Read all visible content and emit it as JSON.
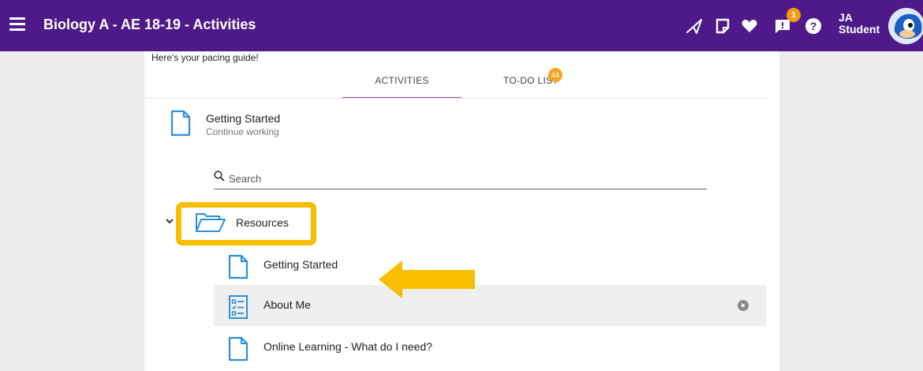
{
  "header": {
    "title": "Biology A - AE 18-19 - Activities",
    "notification_count": "1",
    "user_initials": "JA",
    "user_label": "Student"
  },
  "panel": {
    "pacing_text": "Here's your pacing guide!",
    "tabs": [
      {
        "label": "ACTIVITIES",
        "active": true
      },
      {
        "label": "TO-DO LIST",
        "badge": "44"
      }
    ],
    "continue_item": {
      "title": "Getting Started",
      "subtitle": "Continue working"
    },
    "search": {
      "placeholder": "Search"
    },
    "folder": {
      "label": "Resources",
      "expanded": true,
      "items": [
        {
          "label": "Getting Started",
          "icon": "document-icon"
        },
        {
          "label": "About Me",
          "icon": "checklist-icon"
        },
        {
          "label": "Online Learning - What do I need?",
          "icon": "document-icon"
        }
      ]
    }
  },
  "colors": {
    "header_bg": "#4e1a8a",
    "accent": "#a64ac9",
    "icon_blue": "#2d8fd9",
    "highlight": "#f7bd00"
  }
}
